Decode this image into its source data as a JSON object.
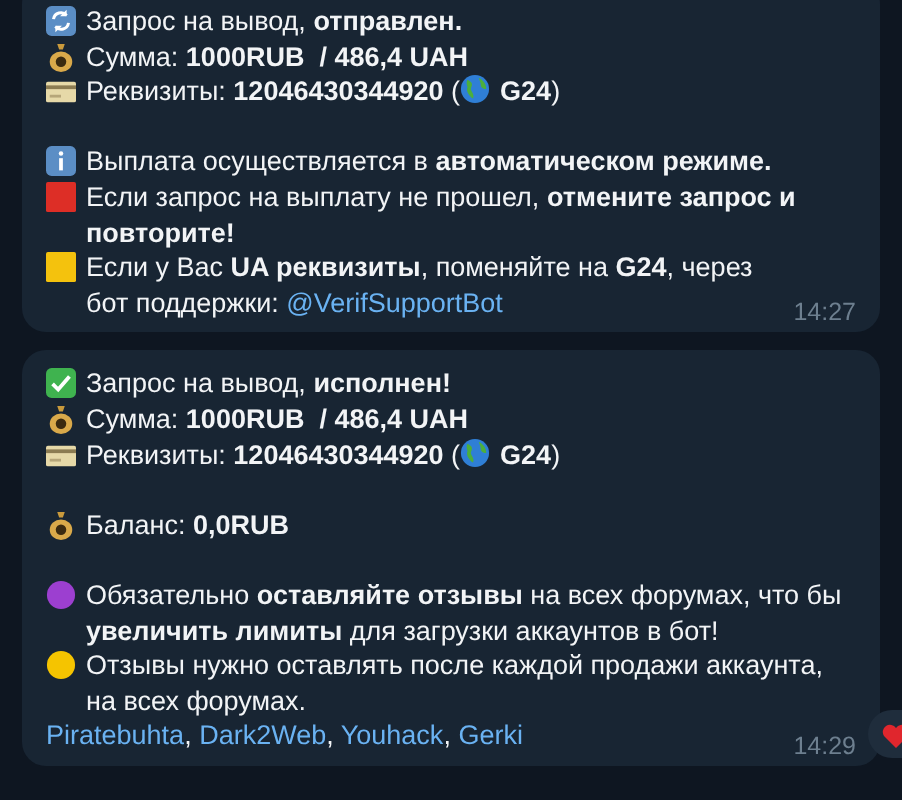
{
  "messages": [
    {
      "lines": [
        {
          "kind": "refresh",
          "text": "Запрос на вывод, **отправлен.**"
        },
        {
          "kind": "moneybag",
          "text": "Сумма: **1000RUB  / 486,4 UAH**"
        },
        {
          "kind": "card",
          "parts": [
            "Реквизиты: **12046430344920** (",
            "**G24**)"
          ]
        },
        {
          "kind": "blank"
        },
        {
          "kind": "info",
          "text": "Выплата осуществляется в **автоматическом режиме.**"
        },
        {
          "kind": "redsquare",
          "text": "Если запрос на выплату не прошел, **отмените запрос и повторите!**"
        },
        {
          "kind": "yellowsquare",
          "text": "Если у Вас **UA реквизиты**, поменяйте на **G24**, через бот поддержки: ",
          "link": "@VerifSupportBot"
        }
      ],
      "time": "14:27",
      "reaction": false
    },
    {
      "lines": [
        {
          "kind": "check",
          "text": "Запрос на вывод, **исполнен!**"
        },
        {
          "kind": "moneybag",
          "text": "Сумма: **1000RUB  / 486,4 UAH**"
        },
        {
          "kind": "card",
          "parts": [
            "Реквизиты: **12046430344920** (",
            "**G24**)"
          ]
        },
        {
          "kind": "blank"
        },
        {
          "kind": "moneybag",
          "text": "Баланс: **0,0RUB**"
        },
        {
          "kind": "blank"
        },
        {
          "kind": "purplecircle",
          "text": "Обязательно **оставляйте отзывы** на всех форумах, что бы **увеличить лимиты** для загрузки аккаунтов в бот!"
        },
        {
          "kind": "yellowcircle",
          "text": "Отзывы нужно оставлять после каждой продажи аккаунта, на всех форумах."
        },
        {
          "kind": "links",
          "links": [
            "Piratebuhta",
            "Dark2Web",
            "Youhack",
            "Gerki"
          ],
          "separator": ", "
        }
      ],
      "time": "14:29",
      "reaction": true
    }
  ]
}
